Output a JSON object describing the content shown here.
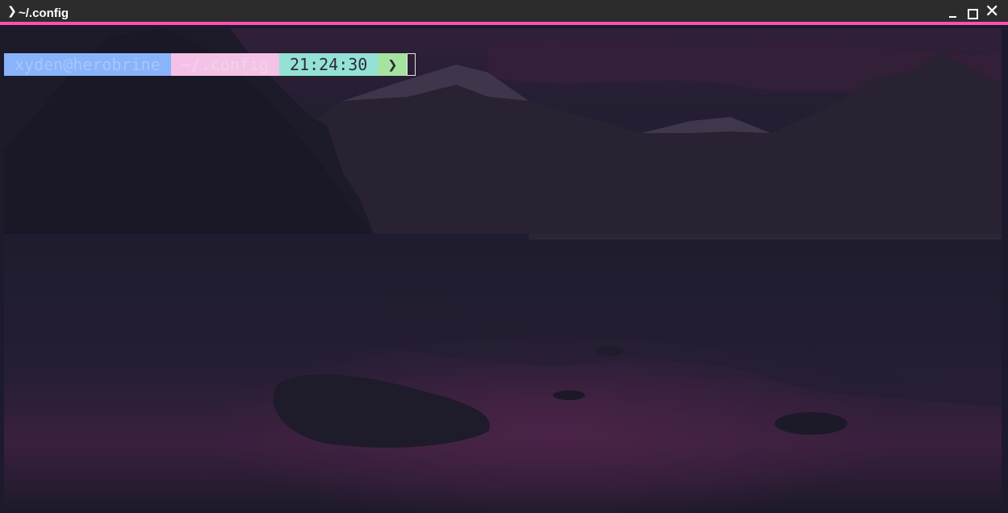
{
  "window": {
    "title_icon": "❯",
    "title": "~/.config",
    "controls": {
      "minimize_icon": "minimize-icon",
      "maximize_icon": "maximize-icon",
      "close_icon": "close-icon",
      "close_glyph": "✕"
    },
    "accent_color": "#ff4fb0"
  },
  "prompt": {
    "user_host": "xyden@herobrine",
    "path": "~/.config",
    "time": "21:24:30",
    "arrow": "❯",
    "colors": {
      "user": "#89b4fa",
      "path": "#f5c2e7",
      "time": "#94e2d5",
      "arrow": "#a6e3a1"
    }
  }
}
